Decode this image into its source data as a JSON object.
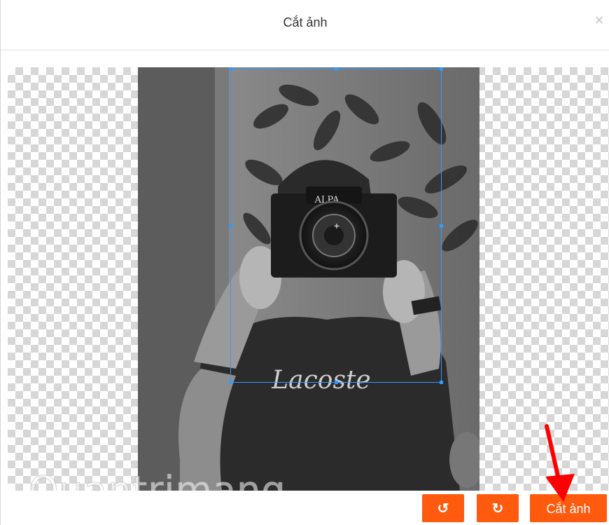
{
  "dialog": {
    "title": "Cắt ảnh",
    "close_label": "×"
  },
  "toolbar": {
    "rotate_left_label": "↺",
    "rotate_right_label": "↻",
    "crop_label": "Cắt ảnh"
  },
  "image": {
    "logo_text": "ALPA",
    "shirt_text": "Lacoste"
  },
  "watermark": {
    "text": "Quantrimang"
  },
  "colors": {
    "accent": "#ff5a0d",
    "crop_border": "#3399ff",
    "arrow": "#ff0000"
  },
  "icons": {
    "close": "close-icon",
    "rotate_left": "rotate-left-icon",
    "rotate_right": "rotate-right-icon",
    "annotation_arrow": "arrow-icon"
  }
}
